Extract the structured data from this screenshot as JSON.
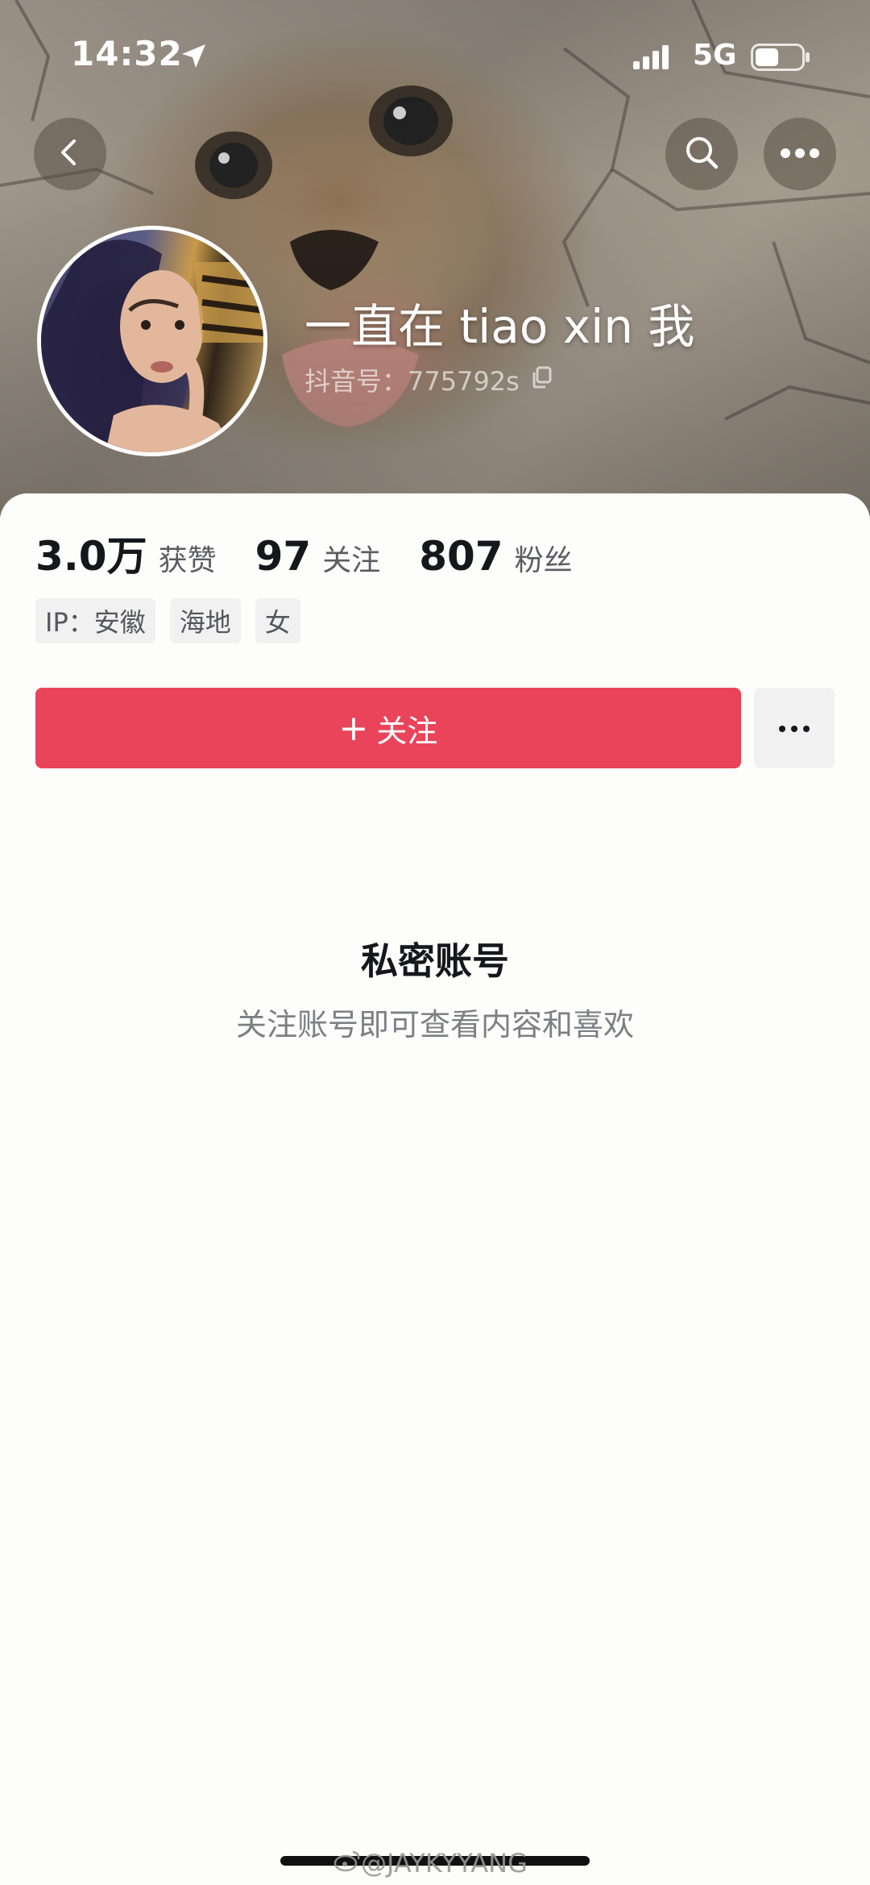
{
  "status_bar": {
    "time": "14:32",
    "network": "5G",
    "battery_level": 0.5
  },
  "header": {
    "back_icon": "chevron-left-icon",
    "search_icon": "search-icon",
    "more_icon": "more-horizontal-icon"
  },
  "profile": {
    "username": "一直在 tiao xin 我",
    "account_id": "抖音号：775792s",
    "copy_icon": "copy-icon"
  },
  "stats": [
    {
      "value": "3.0万",
      "label": "获赞"
    },
    {
      "value": "97",
      "label": "关注"
    },
    {
      "value": "807",
      "label": "粉丝"
    }
  ],
  "tags": [
    "IP：安徽",
    "海地",
    "女"
  ],
  "actions": {
    "follow_plus": "+",
    "follow_label": "关注",
    "more_icon": "more-horizontal-icon"
  },
  "private_notice": {
    "title": "私密账号",
    "subtitle": "关注账号即可查看内容和喜欢"
  },
  "watermark": "@JAYKYYANG",
  "colors": {
    "accent": "#ea445a",
    "tag_bg": "#f1f1f1",
    "text_primary": "#16161d",
    "text_secondary": "#7e7f85"
  }
}
